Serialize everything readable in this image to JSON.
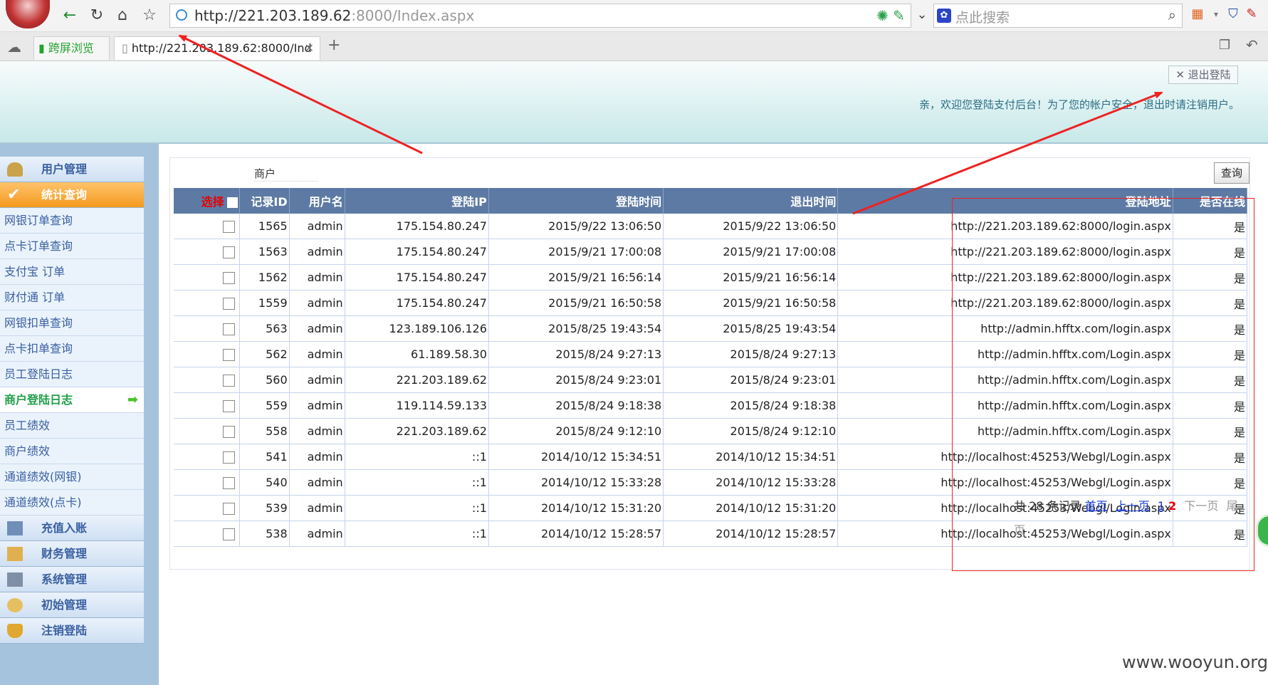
{
  "browser": {
    "url": {
      "host": "http://221.203.189.62",
      "rest": ":8000/Index.aspx"
    },
    "search_placeholder": "点此搜索",
    "tabs": [
      {
        "label": "跨屏浏览"
      },
      {
        "label": "http://221.203.189.62:8000/Ind"
      }
    ]
  },
  "header": {
    "logout": "退出登陆",
    "welcome": "亲，欢迎您登陆支付后台！为了您的帐户安全，退出时请注销用户。"
  },
  "sidebar": {
    "items": [
      {
        "label": "用户管理"
      },
      {
        "label": "统计查询"
      },
      {
        "label": "网银订单查询"
      },
      {
        "label": "点卡订单查询"
      },
      {
        "label": "支付宝 订单"
      },
      {
        "label": "财付通 订单"
      },
      {
        "label": "网银扣单查询"
      },
      {
        "label": "点卡扣单查询"
      },
      {
        "label": "员工登陆日志"
      },
      {
        "label": "商户登陆日志"
      },
      {
        "label": "员工绩效"
      },
      {
        "label": "商户绩效"
      },
      {
        "label": "通道绩效(网银)"
      },
      {
        "label": "通道绩效(点卡)"
      },
      {
        "label": "充值入账"
      },
      {
        "label": "财务管理"
      },
      {
        "label": "系统管理"
      },
      {
        "label": "初始管理"
      },
      {
        "label": "注销登陆"
      }
    ]
  },
  "filter": {
    "label": "商户",
    "query_button": "查询"
  },
  "table": {
    "headers": [
      "选择",
      "记录ID",
      "用户名",
      "登陆IP",
      "登陆时间",
      "退出时间",
      "登陆地址",
      "是否在线"
    ],
    "rows": [
      [
        "1565",
        "admin",
        "175.154.80.247",
        "2015/9/22 13:06:50",
        "2015/9/22 13:06:50",
        "http://221.203.189.62:8000/login.aspx",
        "是"
      ],
      [
        "1563",
        "admin",
        "175.154.80.247",
        "2015/9/21 17:00:08",
        "2015/9/21 17:00:08",
        "http://221.203.189.62:8000/login.aspx",
        "是"
      ],
      [
        "1562",
        "admin",
        "175.154.80.247",
        "2015/9/21 16:56:14",
        "2015/9/21 16:56:14",
        "http://221.203.189.62:8000/login.aspx",
        "是"
      ],
      [
        "1559",
        "admin",
        "175.154.80.247",
        "2015/9/21 16:50:58",
        "2015/9/21 16:50:58",
        "http://221.203.189.62:8000/login.aspx",
        "是"
      ],
      [
        "563",
        "admin",
        "123.189.106.126",
        "2015/8/25 19:43:54",
        "2015/8/25 19:43:54",
        "http://admin.hfftx.com/login.aspx",
        "是"
      ],
      [
        "562",
        "admin",
        "61.189.58.30",
        "2015/8/24 9:27:13",
        "2015/8/24 9:27:13",
        "http://admin.hfftx.com/Login.aspx",
        "是"
      ],
      [
        "560",
        "admin",
        "221.203.189.62",
        "2015/8/24 9:23:01",
        "2015/8/24 9:23:01",
        "http://admin.hfftx.com/Login.aspx",
        "是"
      ],
      [
        "559",
        "admin",
        "119.114.59.133",
        "2015/8/24 9:18:38",
        "2015/8/24 9:18:38",
        "http://admin.hfftx.com/Login.aspx",
        "是"
      ],
      [
        "558",
        "admin",
        "221.203.189.62",
        "2015/8/24 9:12:10",
        "2015/8/24 9:12:10",
        "http://admin.hfftx.com/Login.aspx",
        "是"
      ],
      [
        "541",
        "admin",
        "::1",
        "2014/10/12 15:34:51",
        "2014/10/12 15:34:51",
        "http://localhost:45253/Webgl/Login.aspx",
        "是"
      ],
      [
        "540",
        "admin",
        "::1",
        "2014/10/12 15:33:28",
        "2014/10/12 15:33:28",
        "http://localhost:45253/Webgl/Login.aspx",
        "是"
      ],
      [
        "539",
        "admin",
        "::1",
        "2014/10/12 15:31:20",
        "2014/10/12 15:31:20",
        "http://localhost:45253/Webgl/Login.aspx",
        "是"
      ],
      [
        "538",
        "admin",
        "::1",
        "2014/10/12 15:28:57",
        "2014/10/12 15:28:57",
        "http://localhost:45253/Webgl/Login.aspx",
        "是"
      ]
    ]
  },
  "pager": {
    "total": "共 28 条记录",
    "first": "首页",
    "prev": "上一页",
    "page1": "1",
    "page2": "2",
    "next": "下一页",
    "last": "尾页"
  },
  "watermark": "www.wooyun.org",
  "colors": {
    "header_bg": "#5d7aa4",
    "active_menu": "#f49a1e",
    "annotation": "#ee2222"
  }
}
